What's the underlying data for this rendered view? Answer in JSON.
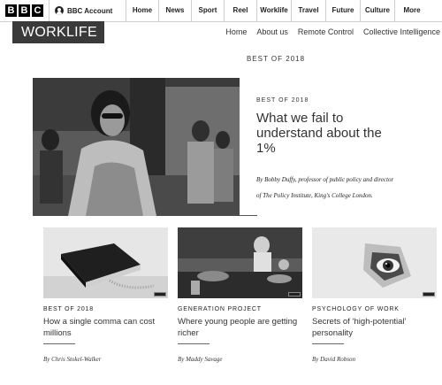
{
  "bbc": {
    "logo_letters": [
      "B",
      "B",
      "C"
    ],
    "account_label": "BBC Account",
    "nav": [
      "Home",
      "News",
      "Sport",
      "Reel",
      "Worklife",
      "Travel",
      "Future",
      "Culture",
      "More"
    ]
  },
  "worklife": {
    "brand": "WORKLIFE",
    "subnav": [
      "Home",
      "About us",
      "Remote Control",
      "Collective Intelligence"
    ]
  },
  "section_label": "BEST OF 2018",
  "hero": {
    "kicker": "BEST OF 2018",
    "title": "What we fail to understand about the 1%",
    "byline_line1": "By Bobby Duffy, professor of public policy and director",
    "byline_line2": "of The Policy Institute, King's College London."
  },
  "cards": [
    {
      "kicker": "BEST OF 2018",
      "title": "How a single comma can cost millions",
      "byline": "By Chris Stokel-Walker"
    },
    {
      "kicker": "GENERATION PROJECT",
      "title": "Where young people are getting richer",
      "byline": "By Maddy Savage"
    },
    {
      "kicker": "PSYCHOLOGY OF WORK",
      "title": "Secrets of ‘high-potential’ personality",
      "byline": "By David Robson"
    }
  ],
  "icons": {
    "account": "person-icon"
  },
  "colors": {
    "brand_bg": "#3a3a3a",
    "logo_bg": "#000000"
  }
}
